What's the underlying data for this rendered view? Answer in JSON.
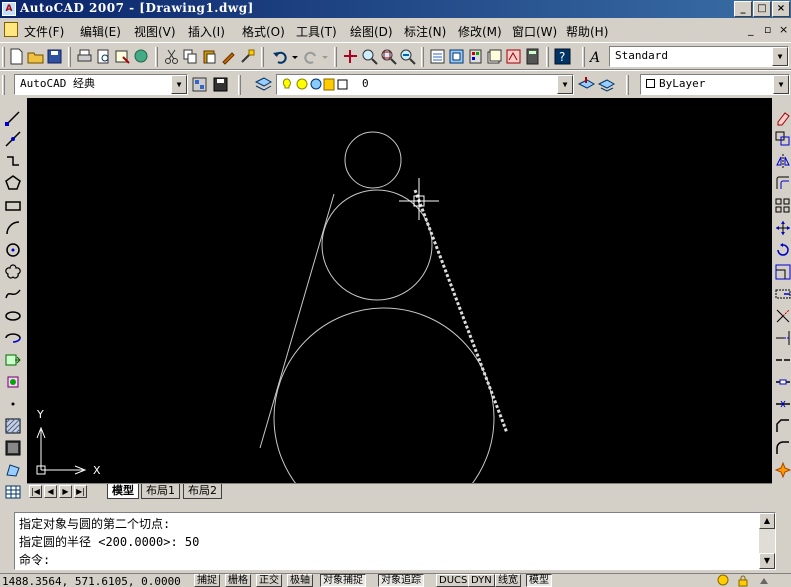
{
  "window": {
    "title": "AutoCAD 2007 - [Drawing1.dwg]",
    "min_label": "_",
    "max_label": "□",
    "close_label": "×"
  },
  "menu": {
    "items": [
      "文件(F)",
      "编辑(E)",
      "视图(V)",
      "插入(I)",
      "格式(O)",
      "工具(T)",
      "绘图(D)",
      "标注(N)",
      "修改(M)",
      "窗口(W)",
      "帮助(H)"
    ],
    "mdi_min": "_",
    "mdi_restore": "▫",
    "mdi_close": "×"
  },
  "toolbar": {
    "text_style": "Standard",
    "workspace": "AutoCAD 经典",
    "layer": "0",
    "color": "ByLayer"
  },
  "layout_tabs": [
    "模型",
    "布局1",
    "布局2"
  ],
  "ucs": {
    "x_label": "X",
    "y_label": "Y"
  },
  "command": {
    "line1": "指定对象与圆的第二个切点:",
    "line2": "指定圆的半径 <200.0000>: 50",
    "prompt": "命令:"
  },
  "status": {
    "coords": "1488.3564, 571.6105, 0.0000",
    "toggles": [
      {
        "label": "捕捉",
        "on": false
      },
      {
        "label": "栅格",
        "on": false
      },
      {
        "label": "正交",
        "on": false
      },
      {
        "label": "极轴",
        "on": false
      },
      {
        "label": "对象捕捉",
        "on": true
      },
      {
        "label": "对象追踪",
        "on": true
      },
      {
        "label": "DUCS",
        "on": false
      },
      {
        "label": "DYN",
        "on": false
      },
      {
        "label": "线宽",
        "on": false
      },
      {
        "label": "模型",
        "on": true
      }
    ]
  },
  "icons": {
    "left_toolbar": [
      "line-icon",
      "construction-line-icon",
      "polyline-icon",
      "polygon-icon",
      "rectangle-icon",
      "arc-icon",
      "circle-icon",
      "revision-cloud-icon",
      "spline-icon",
      "ellipse-icon",
      "ellipse-arc-icon",
      "insert-block-icon",
      "make-block-icon",
      "point-icon",
      "hatch-icon",
      "gradient-icon",
      "region-icon",
      "table-icon"
    ],
    "right_toolbar": [
      "erase-icon",
      "copy-icon",
      "mirror-icon",
      "offset-icon",
      "array-icon",
      "move-icon",
      "rotate-icon",
      "scale-icon",
      "stretch-icon",
      "trim-icon",
      "extend-icon",
      "break-point-icon",
      "break-icon",
      "join-icon",
      "chamfer-icon",
      "fillet-icon",
      "explode-icon"
    ]
  }
}
